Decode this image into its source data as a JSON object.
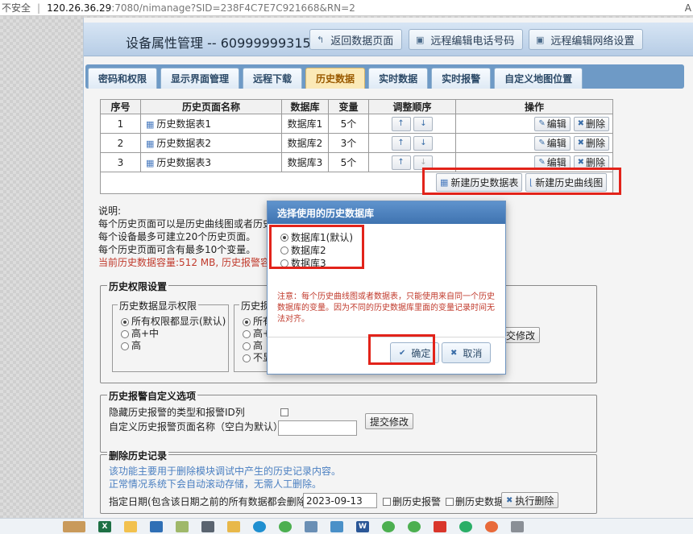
{
  "browser": {
    "insecure_label": "不安全",
    "separator": "|",
    "url_host": "120.26.36.29",
    "url_path": ":7080/nimanage?SID=238F4C7E7C921668&RN=2",
    "right_char": "A"
  },
  "header": {
    "title": "设备属性管理 -- 60999999315",
    "btn_back": "返回数据页面",
    "btn_phone": "远程编辑电话号码",
    "btn_network": "远程编辑网络设置"
  },
  "tabs": [
    "密码和权限",
    "显示界面管理",
    "远程下载",
    "历史数据",
    "实时数据",
    "实时报警",
    "自定义地图位置"
  ],
  "active_tab": 3,
  "table": {
    "headers": [
      "序号",
      "历史页面名称",
      "数据库",
      "变量",
      "调整顺序",
      "操作"
    ],
    "rows": [
      {
        "no": "1",
        "name": "历史数据表1",
        "db": "数据库1",
        "vars": "5个"
      },
      {
        "no": "2",
        "name": "历史数据表2",
        "db": "数据库2",
        "vars": "3个"
      },
      {
        "no": "3",
        "name": "历史数据表3",
        "db": "数据库3",
        "vars": "5个"
      }
    ],
    "up_glyph": "↑",
    "down_glyph": "↓",
    "edit_label": "编辑",
    "delete_label": "删除",
    "new_table_label": "新建历史数据表",
    "new_curve_label": "新建历史曲线图"
  },
  "description": {
    "title": "说明:",
    "line1": "每个历史页面可以是历史曲线图或者历史",
    "line2": "每个设备最多可建立20个历史页面。",
    "line3": "每个历史页面可含有最多10个变量。",
    "line4": "当前历史数据容量:512 MB, 历史报警容量"
  },
  "permission": {
    "legend": "历史权限设置",
    "display_legend": "历史数据显示权限",
    "opt_all": "所有权限都显示(默认)",
    "opt_high_mid": "高+中",
    "opt_high": "高",
    "modify_legend": "历史损",
    "m_all": "所有",
    "m_high_mid": "高+",
    "m_high": "高",
    "m_none": "不显",
    "submit_partial": "交修改"
  },
  "alarm_custom": {
    "legend": "历史报警自定义选项",
    "hide_label": "隐藏历史报警的类型和报警ID列",
    "custom_name_label": "自定义历史报警页面名称（空白为默认）",
    "submit": "提交修改"
  },
  "delete_history": {
    "legend": "删除历史记录",
    "note1": "该功能主要用于删除模块调试中产生的历史记录内容。",
    "note2": "正常情况系统下会自动滚动存储，无需人工删除。",
    "date_label": "指定日期(包含该日期之前的所有数据都会删除)",
    "date_value": "2023-09-13",
    "chk_alarm": "删历史报警",
    "chk_data": "删历史数据",
    "execute": "执行删除"
  },
  "dialog": {
    "title": "选择使用的历史数据库",
    "options": [
      "数据库1(默认)",
      "数据库2",
      "数据库3"
    ],
    "selected": 0,
    "note": "注意：每个历史曲线图或者数据表，只能使用来自同一个历史数据库的变量。因为不同的历史数据库里面的变量记录时间无法对齐。",
    "ok": "确定",
    "cancel": "取消"
  },
  "colors": {
    "accent": "#3f73b0",
    "active_tab": "#fbe9b7",
    "warning": "#c0392b",
    "highlight": "#e2231a"
  },
  "taskbar": {
    "apps": [
      "excel-icon",
      "file-explorer-icon",
      "photos-icon",
      "paint-icon",
      "calculator-icon",
      "folder-icon",
      "edge-icon",
      "chrome-icon",
      "app-icon",
      "app-icon",
      "word-icon",
      "chrome-icon",
      "chrome-icon",
      "app-icon",
      "wechat-icon",
      "app-icon",
      "app-icon"
    ]
  }
}
